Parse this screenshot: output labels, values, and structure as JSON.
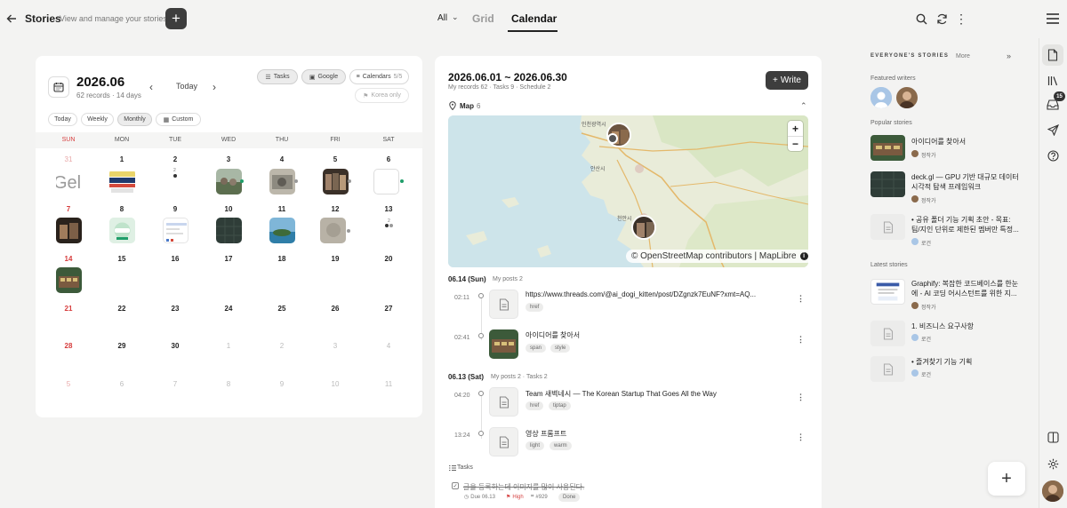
{
  "header": {
    "title": "Stories",
    "subtitle": "View and manage your stories",
    "view_filter": "All",
    "tabs": [
      "Grid",
      "Calendar"
    ],
    "active_tab": "Calendar"
  },
  "calendar": {
    "month": "2026.06",
    "meta": "62 records · 14 days",
    "today_label": "Today",
    "filters": {
      "tasks": "Tasks",
      "google": "Google",
      "calendars": "Calendars",
      "calendars_count": "5/5",
      "korea_only": "Korea only"
    },
    "views": [
      "Today",
      "Weekly",
      "Monthly",
      "Custom"
    ],
    "active_view": "Monthly",
    "weekdays": [
      "SUN",
      "MON",
      "TUE",
      "WED",
      "THU",
      "FRI",
      "SAT"
    ],
    "weeks": [
      [
        "31",
        "1",
        "2",
        "3",
        "4",
        "5",
        "6"
      ],
      [
        "7",
        "8",
        "9",
        "10",
        "11",
        "12",
        "13"
      ],
      [
        "14",
        "15",
        "16",
        "17",
        "18",
        "19",
        "20"
      ],
      [
        "21",
        "22",
        "23",
        "24",
        "25",
        "26",
        "27"
      ],
      [
        "28",
        "29",
        "30",
        "1",
        "2",
        "3",
        "4"
      ],
      [
        "5",
        "6",
        "7",
        "8",
        "9",
        "10",
        "11"
      ]
    ],
    "day2_count": "2",
    "day13_count": "2"
  },
  "feed": {
    "range": "2026.06.01 ~ 2026.06.30",
    "meta": "My records 62 · Tasks 9 · Schedule 2",
    "write_label": "Write",
    "map_label": "Map",
    "map_count": "6",
    "map_attribution": "© OpenStreetMap contributors | MapLibre",
    "map_places": [
      "인천광역시",
      "안산시",
      "천안시"
    ],
    "days": [
      {
        "date": "06.14 (Sun)",
        "summary": "My posts 2",
        "posts": [
          {
            "time": "02:11",
            "title": "https://www.threads.com/@ai_dogi_kitten/post/DZgnzk7EuNF?xmt=AQ...",
            "tags": [
              "href"
            ]
          },
          {
            "time": "02:41",
            "title": "아이디어를 찾아서",
            "tags": [
              "span",
              "style"
            ]
          }
        ]
      },
      {
        "date": "06.13 (Sat)",
        "summary": "My posts 2 · Tasks 2",
        "posts": [
          {
            "time": "04:20",
            "title": "Team 새벽네시 — The Korean Startup That Goes All the Way",
            "tags": [
              "href",
              "tiptap"
            ]
          },
          {
            "time": "13:24",
            "title": "영상 프롬프트",
            "tags": [
              "light",
              "warm"
            ]
          }
        ]
      }
    ],
    "tasks_label": "Tasks",
    "task": {
      "text": "글을 등록하는데 이미지를 많이 사용된다.",
      "due": "Due 06.13",
      "priority": "High",
      "ref": "#929",
      "status": "Done"
    }
  },
  "side": {
    "title": "EVERYONE'S STORIES",
    "more": "More",
    "featured_label": "Featured writers",
    "popular_label": "Popular stories",
    "latest_label": "Latest stories",
    "popular": [
      {
        "title": "아이디어를 찾아서",
        "author": "정작가"
      },
      {
        "title": "deck.gl — GPU 기반 대규모 데이터 시각적 탐색 프레임워크",
        "author": "정작가"
      },
      {
        "title": "• 공유 폴더 기능 기획 초안 - 목표: 팀/지인 단위로 제한된 멤버만 특정...",
        "author": "로건"
      }
    ],
    "latest": [
      {
        "title": "Graphify: 복잡한 코드베이스를 한눈에 - AI 코딩 어시스턴트를 위한 지...",
        "author": "정작가"
      },
      {
        "title": "1. 비즈니스 요구사항",
        "author": "로건"
      },
      {
        "title": "• 즐겨찾기 기능 기획",
        "author": "로건"
      }
    ]
  },
  "rail": {
    "inbox_badge": "15"
  },
  "colors": {
    "accent": "#3d3d3d",
    "sunday": "#d63c3c",
    "priority_high": "#d64545",
    "event_dot": "#1f9e6a"
  }
}
